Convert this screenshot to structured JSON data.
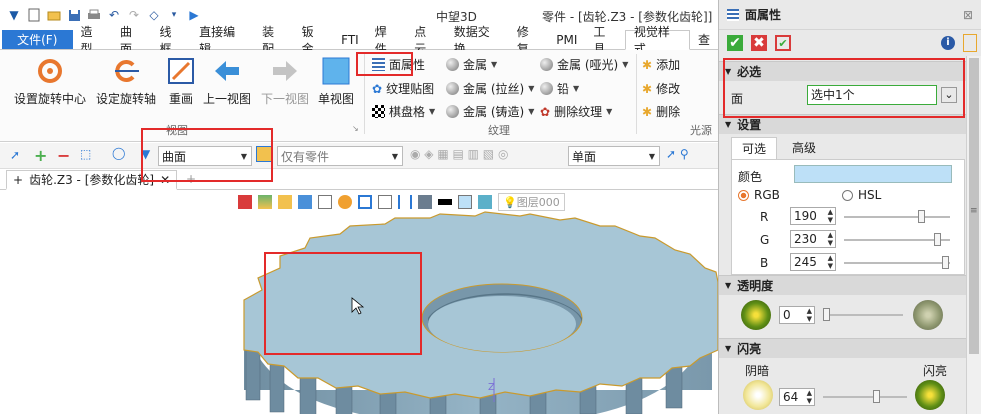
{
  "titlebar": {
    "app_name": "中望3D",
    "document": "零件 - [齿轮.Z3 - [参数化齿轮]]"
  },
  "menu": {
    "file": "文件(F)",
    "tabs": [
      "造型",
      "曲面",
      "线框",
      "直接编辑",
      "装配",
      "钣金",
      "FTI",
      "焊件",
      "点云",
      "数据交换",
      "修复",
      "PMI",
      "工具",
      "视觉样式",
      "查"
    ],
    "active_tab": "视觉样式"
  },
  "ribbon": {
    "view_buttons": [
      "设置旋转中心",
      "设定旋转轴",
      "重画",
      "上一视图",
      "下一视图",
      "单视图"
    ],
    "view_group": "视图",
    "texture_items": {
      "face_props": "面属性",
      "texture_map": "纹理贴图",
      "checker": "棋盘格",
      "metal": "金属",
      "metal_brushed": "金属 (拉丝)",
      "metal_cast": "金属 (铸造)",
      "metal_matte": "金属 (哑光)",
      "lead": "铅",
      "delete_texture": "删除纹理"
    },
    "texture_group": "纹理",
    "light_items": {
      "add": "添加",
      "modify": "修改",
      "delete": "删除"
    },
    "light_group": "光源"
  },
  "filterbar": {
    "filter_value": "曲面",
    "part_only_placeholder": "仅有零件",
    "view_value": "单面"
  },
  "doctab": {
    "label": "齿轮.Z3 - [参数化齿轮]",
    "pin": "+",
    "close": "✕",
    "new": "+"
  },
  "viewport": {
    "layer_label": "图层000"
  },
  "panel": {
    "title": "面属性",
    "required_section": "必选",
    "face_label": "面",
    "face_value": "选中1个",
    "settings_section": "设置",
    "tabs": [
      "可选",
      "高级"
    ],
    "color_label": "颜色",
    "color_value": "#bde0f7",
    "rgb_label": "RGB",
    "hsl_label": "HSL",
    "r_label": "R",
    "g_label": "G",
    "b_label": "B",
    "r_value": "190",
    "g_value": "230",
    "b_value": "245",
    "transparency_section": "透明度",
    "transparency_value": "0",
    "shine_section": "闪亮",
    "dim_label": "阴暗",
    "shine_label": "闪亮",
    "shine_value": "64"
  },
  "colors": {
    "accent": "#2b78d4",
    "highlight": "#e32a2a",
    "gear": "#a7c6d6"
  }
}
